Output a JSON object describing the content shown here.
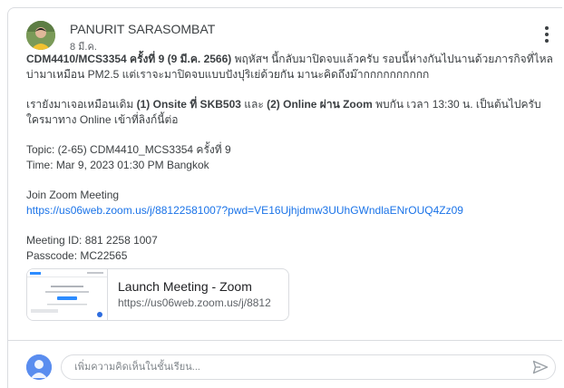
{
  "post": {
    "author": "PANURIT SARASOMBAT",
    "date": "8 มี.ค.",
    "p1_bold": "CDM4410/MCS3354 ครั้งที่ 9 (9 มี.ค. 2566)",
    "p1_text": " พฤหัสฯ นี้กลับมาปิดจบแล้วครับ รอบนี้ห่างกันไปนานด้วยภารกิจที่ไหลบ่ามาเหมือน PM2.5 แต่เราจะมาปิดจบแบบปังปุริเย่ด้วยกัน มานะคิดถึงม๊ากกกกกกกกกก",
    "p2_a": "เรายังมาเจอเหมือนเดิม ",
    "p2_b1": "(1) Onsite ที่ SKB503",
    "p2_c": " และ ",
    "p2_b2": "(2) Online ผ่าน Zoom",
    "p2_d": " พบกัน เวลา 13:30 น. เป็นต้นไปครับ ใครมาทาง Online เข้าที่ลิงก์นี้ต่อ",
    "topic": "Topic: (2-65) CDM4410_MCS3354 ครั้งที่ 9",
    "time": "Time: Mar 9, 2023 01:30 PM Bangkok",
    "join_label": "Join Zoom Meeting",
    "join_link": "https://us06web.zoom.us/j/88122581007?pwd=VE16Ujhjdmw3UUhGWndlaENrOUQ4Zz09",
    "meeting_id": "Meeting ID: 881 2258 1007",
    "passcode": "Passcode: MC22565"
  },
  "attachment": {
    "title": "Launch Meeting - Zoom",
    "url": "https://us06web.zoom.us/j/8812"
  },
  "comment": {
    "placeholder": "เพิ่มความคิดเห็นในชั้นเรียน..."
  },
  "colors": {
    "link": "#1a73e8",
    "avatar_blue": "#5a8def"
  }
}
